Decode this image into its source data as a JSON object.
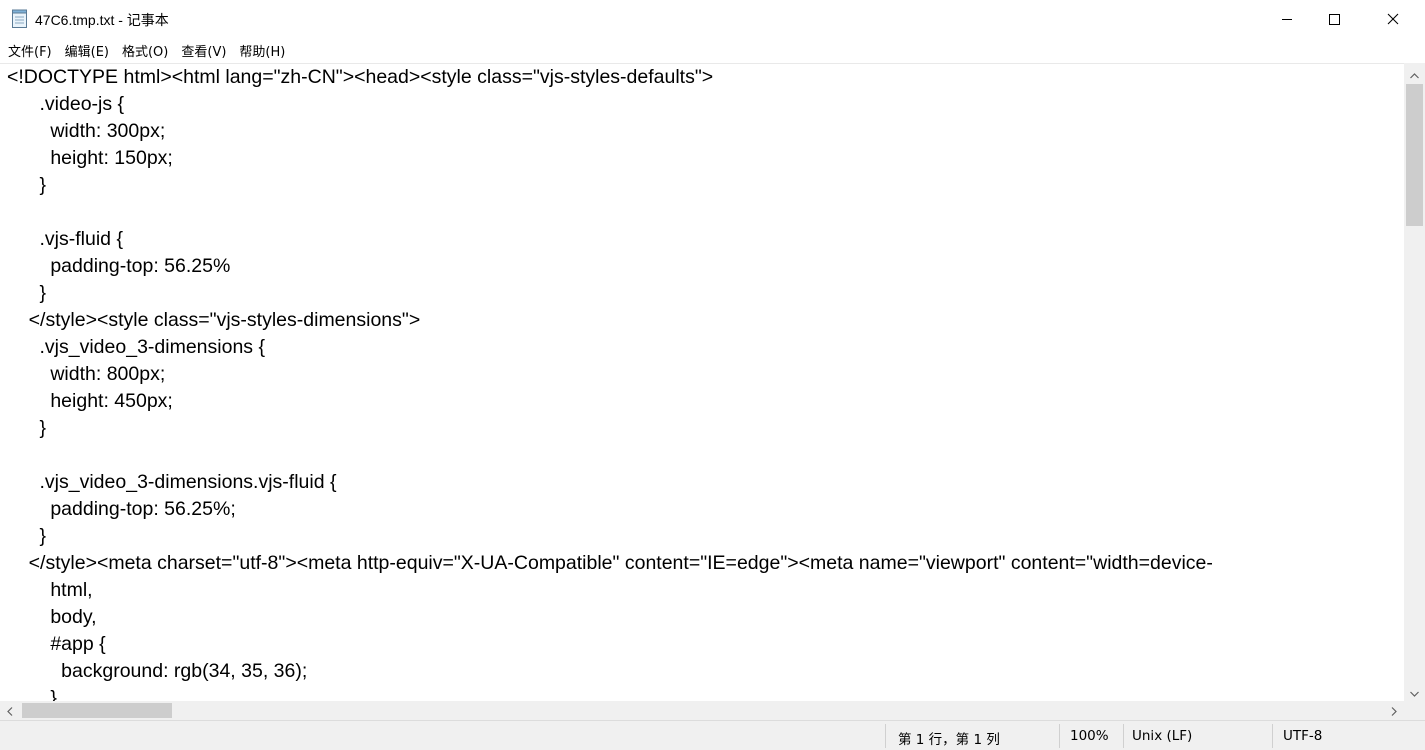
{
  "window": {
    "title": "47C6.tmp.txt - 记事本",
    "icon": "notepad-icon",
    "controls": {
      "minimize_icon": "minimize-icon",
      "maximize_icon": "maximize-icon",
      "close_icon": "close-icon"
    }
  },
  "menu": {
    "items": [
      {
        "label": "文件(F)"
      },
      {
        "label": "编辑(E)"
      },
      {
        "label": "格式(O)"
      },
      {
        "label": "查看(V)"
      },
      {
        "label": "帮助(H)"
      }
    ]
  },
  "editor": {
    "lines": [
      "<!DOCTYPE html><html lang=\"zh-CN\"><head><style class=\"vjs-styles-defaults\">",
      "      .video-js {",
      "        width: 300px;",
      "        height: 150px;",
      "      }",
      "",
      "      .vjs-fluid {",
      "        padding-top: 56.25%",
      "      }",
      "    </style><style class=\"vjs-styles-dimensions\">",
      "      .vjs_video_3-dimensions {",
      "        width: 800px;",
      "        height: 450px;",
      "      }",
      "",
      "      .vjs_video_3-dimensions.vjs-fluid {",
      "        padding-top: 56.25%;",
      "      }",
      "    </style><meta charset=\"utf-8\"><meta http-equiv=\"X-UA-Compatible\" content=\"IE=edge\"><meta name=\"viewport\" content=\"width=device-",
      "        html,",
      "        body,",
      "        #app {",
      "          background: rgb(34, 35, 36);",
      "        }"
    ]
  },
  "status": {
    "position": "第 1 行，第 1 列",
    "zoom": "100%",
    "line_ending": "Unix (LF)",
    "encoding": "UTF-8"
  }
}
